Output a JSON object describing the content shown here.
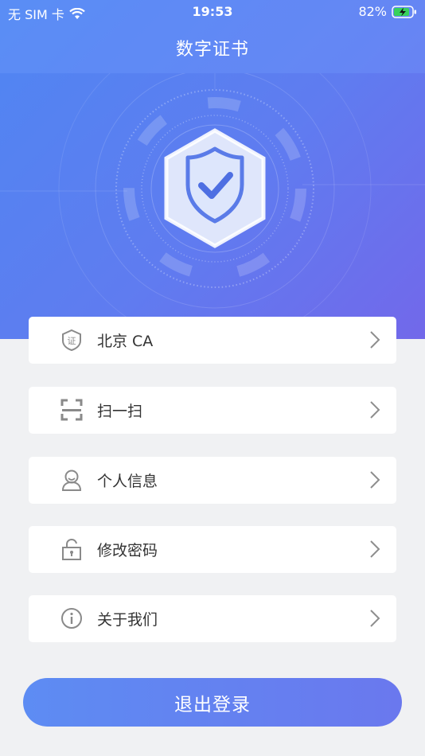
{
  "status_bar": {
    "carrier": "无 SIM 卡",
    "time": "19:53",
    "battery": "82%"
  },
  "header": {
    "title": "数字证书"
  },
  "menu": [
    {
      "label": "北京 CA",
      "icon": "certificate-icon"
    },
    {
      "label": "扫一扫",
      "icon": "scan-icon"
    },
    {
      "label": "个人信息",
      "icon": "user-icon"
    },
    {
      "label": "修改密码",
      "icon": "unlock-icon"
    },
    {
      "label": "关于我们",
      "icon": "info-icon"
    }
  ],
  "logout_label": "退出登录",
  "colors": {
    "gradient_start": "#4f86f2",
    "gradient_end": "#7268ea",
    "background": "#f0f1f3",
    "icon_gray": "#8a8a8a"
  }
}
